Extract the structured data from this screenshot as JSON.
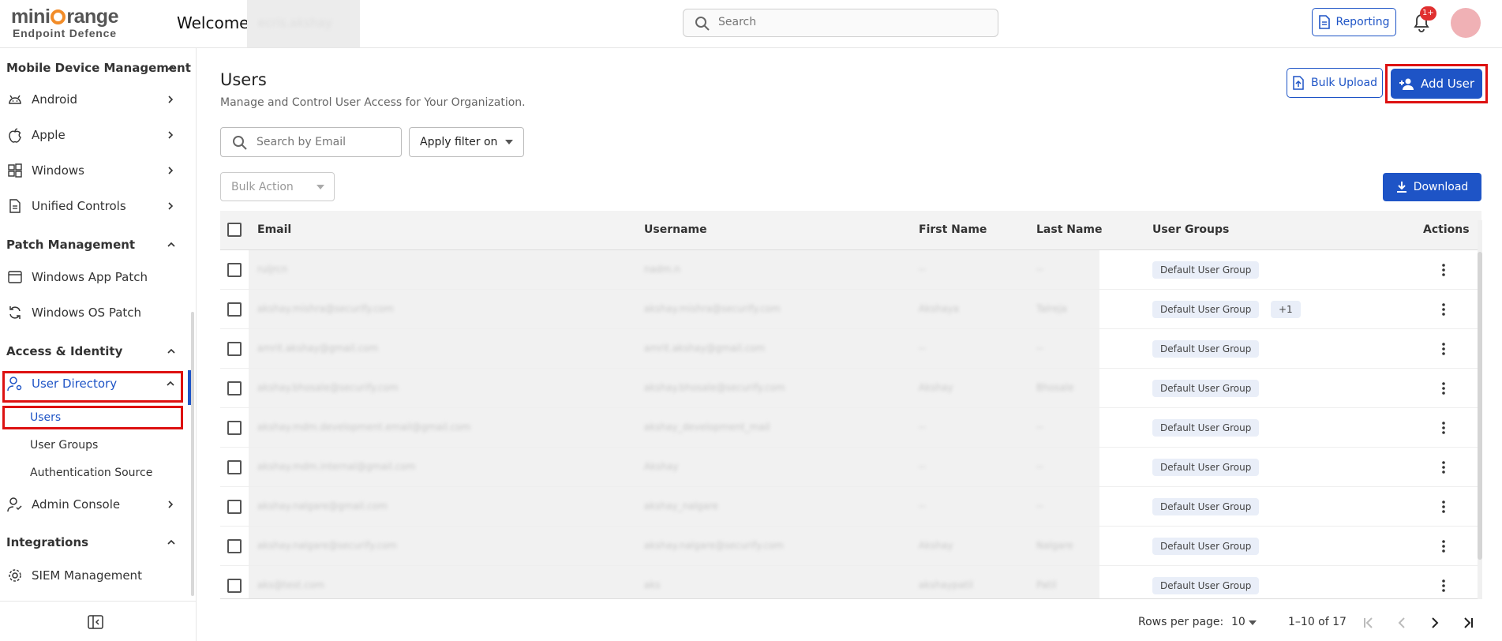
{
  "header": {
    "logo_main_left": "mini",
    "logo_main_right": "range",
    "logo_sub": "Endpoint Defence",
    "welcome": "Welcome",
    "user_name": "ecris.akshay",
    "search_placeholder": "Search",
    "reporting_label": "Reporting",
    "notification_badge": "1+"
  },
  "sidebar": {
    "sections": [
      {
        "label": "Mobile Device Management"
      },
      {
        "label": "Patch Management"
      },
      {
        "label": "Access & Identity"
      },
      {
        "label": "Integrations"
      }
    ],
    "items": [
      {
        "label": "Android",
        "icon": "android-icon"
      },
      {
        "label": "Apple",
        "icon": "apple-icon"
      },
      {
        "label": "Windows",
        "icon": "windows-icon"
      },
      {
        "label": "Unified Controls",
        "icon": "document-icon"
      },
      {
        "label": "Windows App Patch",
        "icon": "app-window-icon"
      },
      {
        "label": "Windows OS Patch",
        "icon": "refresh-icon"
      },
      {
        "label": "User Directory",
        "icon": "user-settings-icon"
      },
      {
        "label": "Admin Console",
        "icon": "admin-icon"
      },
      {
        "label": "SIEM Management",
        "icon": "gear-icon"
      }
    ],
    "subitems": [
      {
        "label": "Users"
      },
      {
        "label": "User Groups"
      },
      {
        "label": "Authentication Source"
      }
    ]
  },
  "main": {
    "title": "Users",
    "subtitle": "Manage and Control User Access for Your Organization.",
    "bulk_upload_label": "Bulk Upload",
    "add_user_label": "Add User",
    "email_search_placeholder": "Search by Email",
    "filter_label": "Apply filter on",
    "bulk_action_label": "Bulk Action",
    "download_label": "Download"
  },
  "table": {
    "columns": [
      "Email",
      "Username",
      "First Name",
      "Last Name",
      "User Groups",
      "Actions"
    ],
    "rows": [
      {
        "email": "ruljrcn",
        "username": "nadm.n",
        "first": "--",
        "last": "--",
        "groups": [
          "Default User Group"
        ]
      },
      {
        "email": "akshay.mishra@securify.com",
        "username": "akshay.mishra@securify.com",
        "first": "Akshaya",
        "last": "Talreja",
        "groups": [
          "Default User Group",
          "+1"
        ]
      },
      {
        "email": "amrit.akshay@gmail.com",
        "username": "amrit.akshay@gmail.com",
        "first": "--",
        "last": "--",
        "groups": [
          "Default User Group"
        ]
      },
      {
        "email": "akshay.bhosale@securify.com",
        "username": "akshay.bhosale@securify.com",
        "first": "Akshay",
        "last": "Bhosale",
        "groups": [
          "Default User Group"
        ]
      },
      {
        "email": "akshay.mdm.development.email@gmail.com",
        "username": "akshay_development_mail",
        "first": "--",
        "last": "--",
        "groups": [
          "Default User Group"
        ]
      },
      {
        "email": "akshay.mdm.internal@gmail.com",
        "username": "Akshay",
        "first": "--",
        "last": "--",
        "groups": [
          "Default User Group"
        ]
      },
      {
        "email": "akshay.nalgare@gmail.com",
        "username": "akshay_nalgare",
        "first": "--",
        "last": "--",
        "groups": [
          "Default User Group"
        ]
      },
      {
        "email": "akshay.nalgare@securify.com",
        "username": "akshay.nalgare@securify.com",
        "first": "Akshay",
        "last": "Nalgare",
        "groups": [
          "Default User Group"
        ]
      },
      {
        "email": "aks@test.com",
        "username": "aks",
        "first": "akshaypatil",
        "last": "Patil",
        "groups": [
          "Default User Group"
        ]
      }
    ]
  },
  "pagination": {
    "rows_per_page_label": "Rows per page:",
    "rows_per_page_value": "10",
    "range": "1–10 of 17"
  },
  "colors": {
    "primary": "#1e54c6",
    "highlight": "#dd1111",
    "chip_bg": "#e9eef8"
  }
}
